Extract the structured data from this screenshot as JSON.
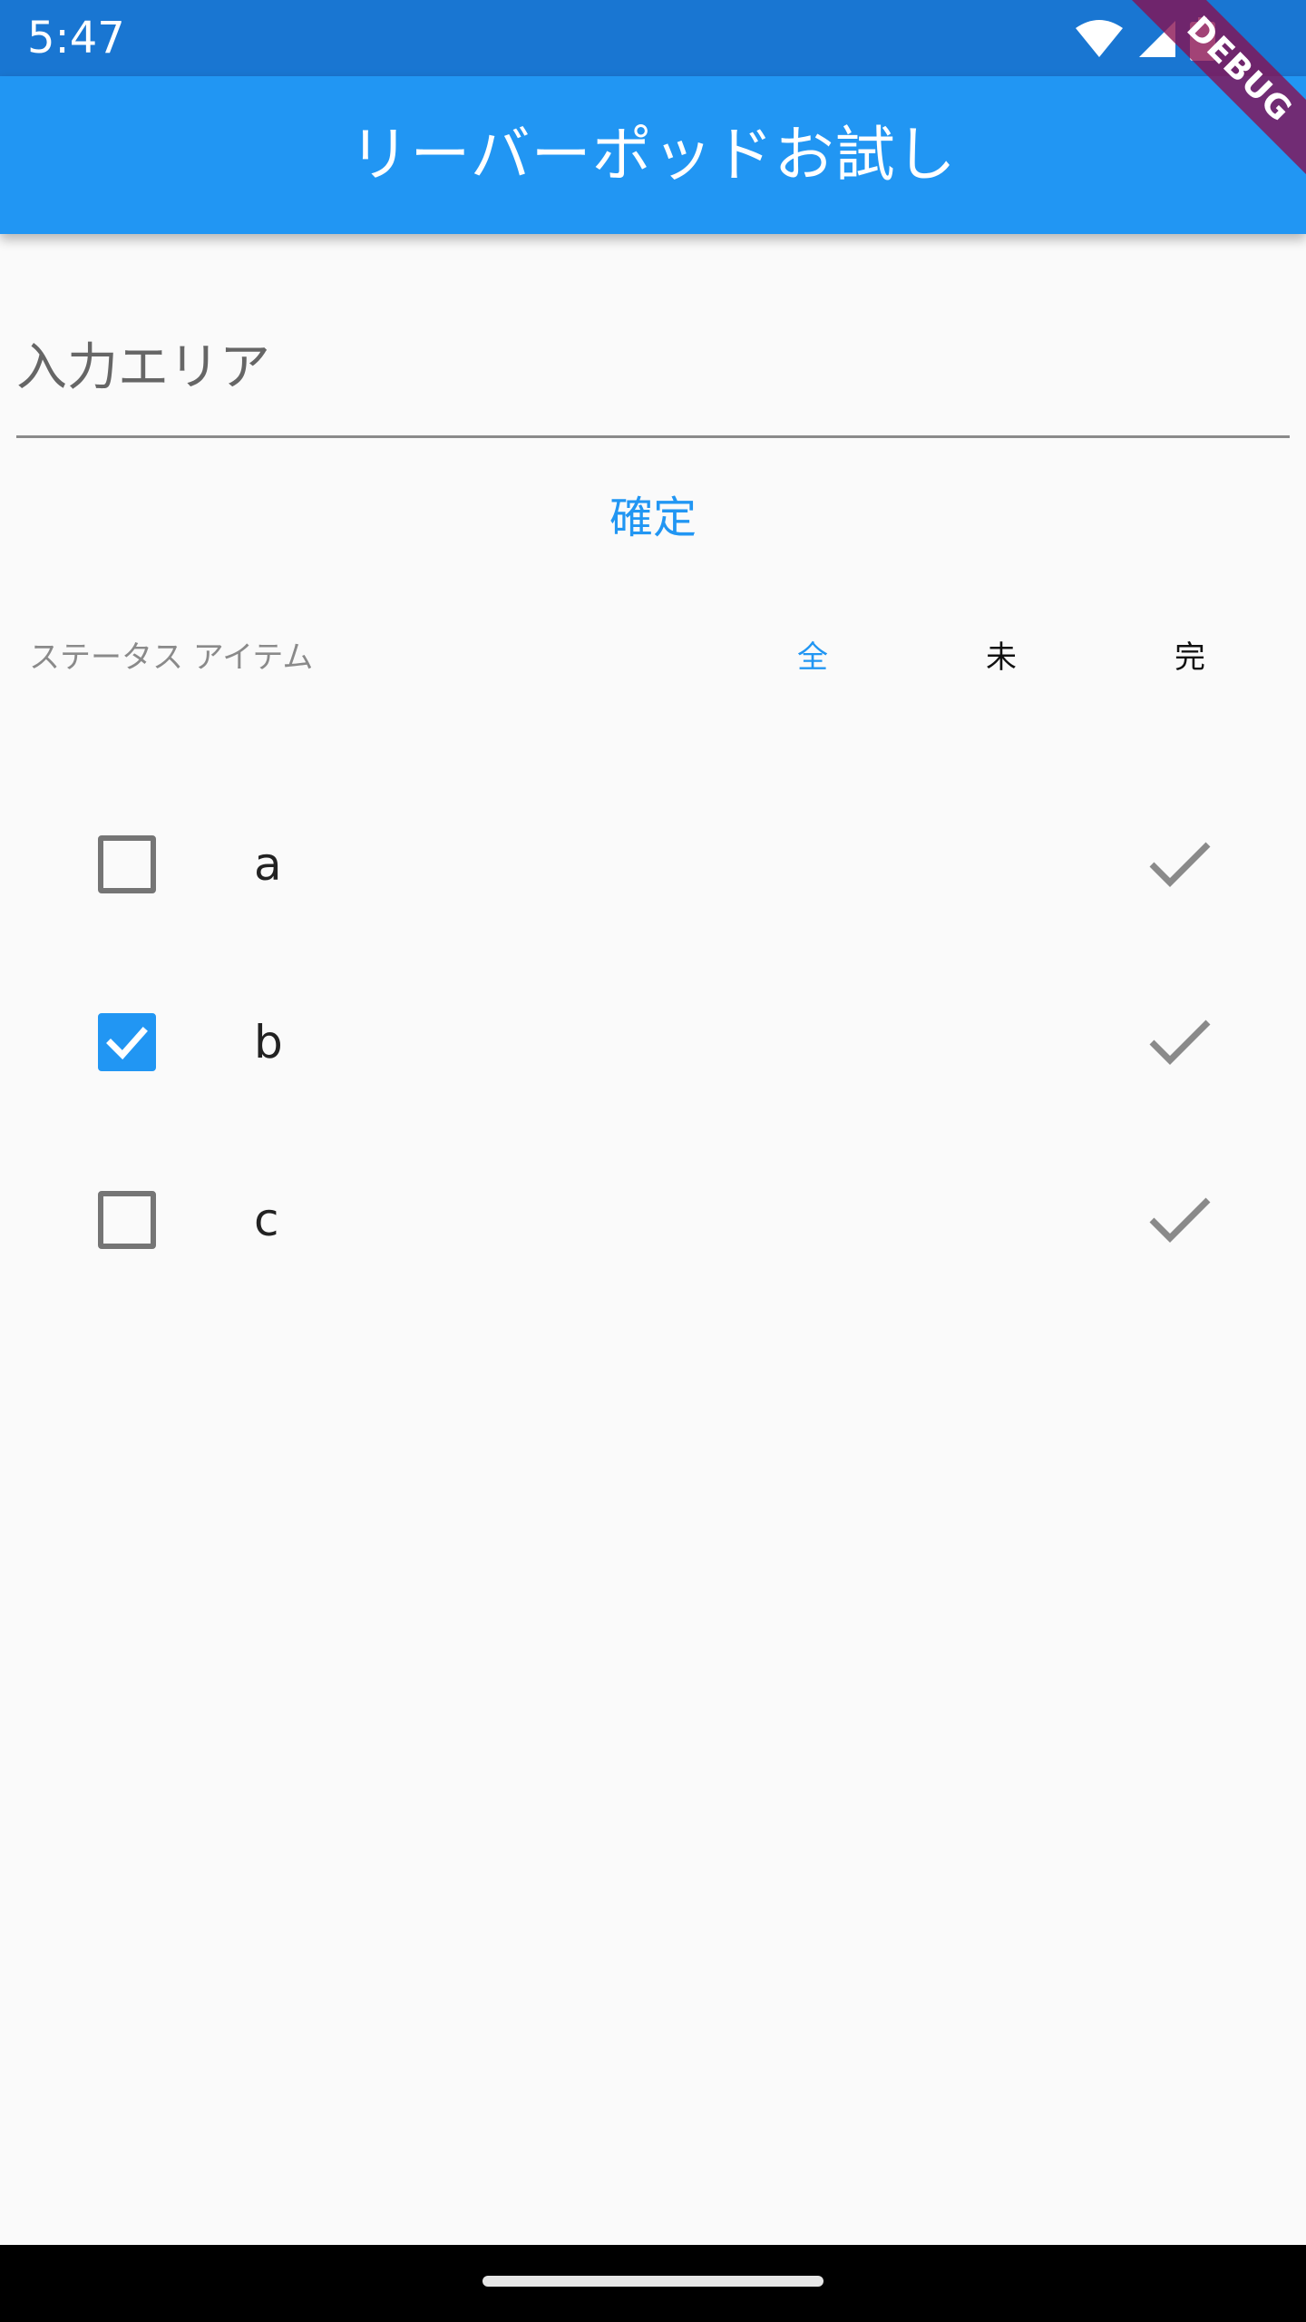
{
  "status_bar": {
    "time": "5:47",
    "icons": [
      "wifi-icon",
      "cell-signal-icon",
      "battery-icon"
    ]
  },
  "app_bar": {
    "title": "リーバーポッドお試し"
  },
  "debug_banner": {
    "label": "DEBUG"
  },
  "input": {
    "placeholder": "入力エリア",
    "value": ""
  },
  "confirm_button": {
    "label": "確定"
  },
  "filter": {
    "caption": "ステータス アイテム",
    "tabs": [
      {
        "label": "全",
        "active": true
      },
      {
        "label": "未",
        "active": false
      },
      {
        "label": "完",
        "active": false
      }
    ]
  },
  "todos": [
    {
      "label": "a",
      "checked": false
    },
    {
      "label": "b",
      "checked": true
    },
    {
      "label": "c",
      "checked": false
    }
  ],
  "colors": {
    "primary": "#2196f3",
    "status_bar": "#1976d2",
    "background": "#fafafa",
    "debug_banner": "#880e4f"
  }
}
